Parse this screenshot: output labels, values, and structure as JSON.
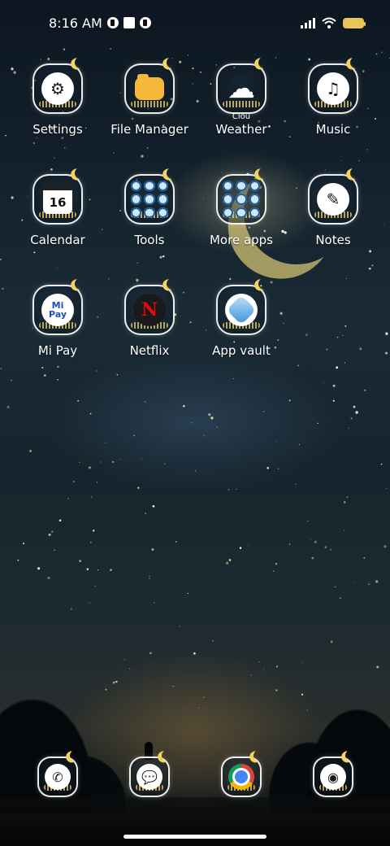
{
  "status_bar": {
    "time": "8:16 AM",
    "notification_icons": [
      "notification-icon-1",
      "notification-icon-2",
      "notification-icon-3"
    ],
    "signal_icon": "signal-icon",
    "wifi_icon": "wifi-icon",
    "battery_icon": "battery-icon"
  },
  "apps": [
    {
      "label": "Settings",
      "icon": "gear-icon"
    },
    {
      "label": "File Manager",
      "icon": "folder-icon"
    },
    {
      "label": "Weather",
      "icon": "weather-icon",
      "sublabel": "Clou"
    },
    {
      "label": "Music",
      "icon": "music-icon"
    },
    {
      "label": "Calendar",
      "icon": "calendar-icon",
      "day": "16"
    },
    {
      "label": "Tools",
      "icon": "folder-grid-icon"
    },
    {
      "label": "More apps",
      "icon": "folder-grid-icon"
    },
    {
      "label": "Notes",
      "icon": "notes-icon"
    },
    {
      "label": "Mi Pay",
      "icon": "mi-pay-icon",
      "icon_text": "Mi Pay"
    },
    {
      "label": "Netflix",
      "icon": "netflix-icon",
      "icon_text": "N"
    },
    {
      "label": "App vault",
      "icon": "app-vault-icon"
    }
  ],
  "dock": [
    {
      "icon": "phone-icon"
    },
    {
      "icon": "messages-icon"
    },
    {
      "icon": "chrome-icon"
    },
    {
      "icon": "camera-icon"
    }
  ],
  "colors": {
    "accent_moon": "#f3d35c",
    "battery": "#e9c45a",
    "netflix_red": "#e50914"
  }
}
